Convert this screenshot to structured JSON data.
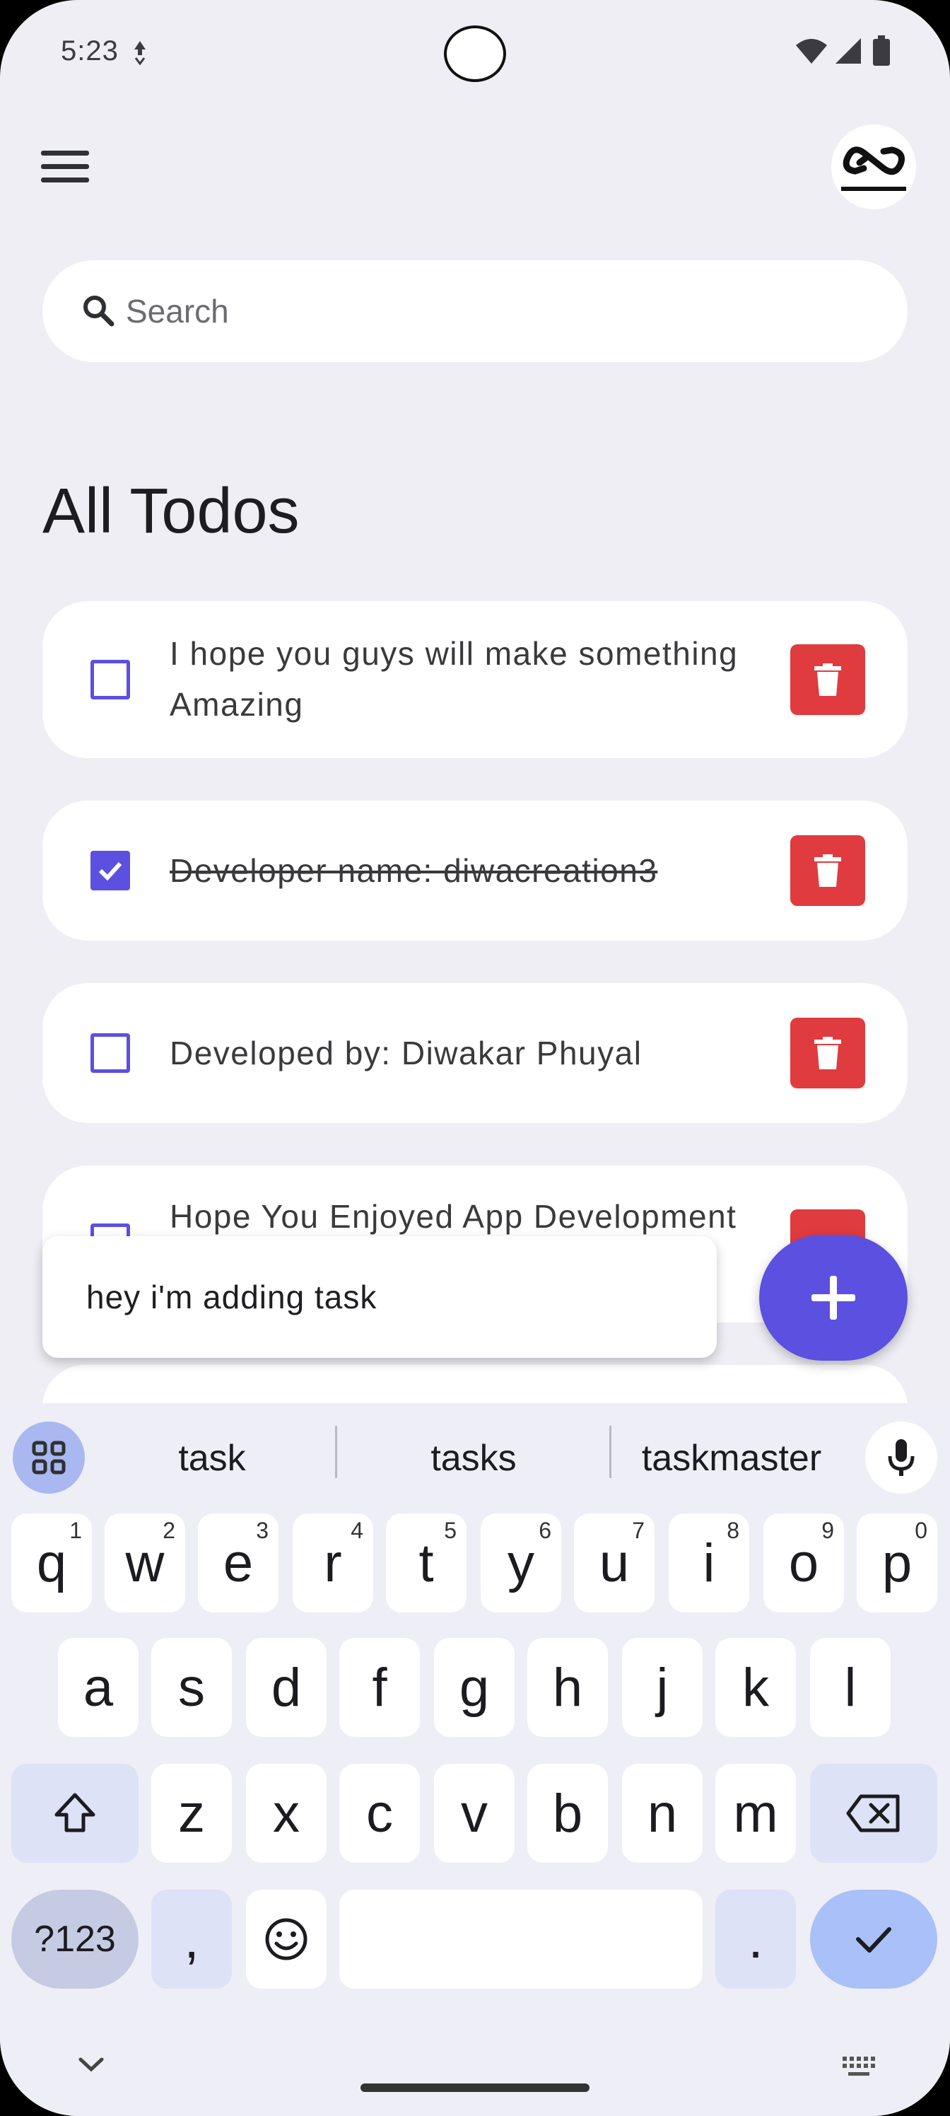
{
  "status_bar": {
    "time": "5:23"
  },
  "search": {
    "placeholder": "Search"
  },
  "page_title": "All Todos",
  "todos": [
    {
      "text": "I hope you guys will make something Amazing",
      "done": false
    },
    {
      "text": "Developer name: diwacreation3",
      "done": true
    },
    {
      "text": "Developed by: Diwakar Phuyal",
      "done": false
    },
    {
      "text": "Hope You Enjoyed App Development",
      "done": false
    }
  ],
  "new_todo_input": {
    "value": "hey i'm adding task"
  },
  "keyboard": {
    "suggestions": [
      "task",
      "tasks",
      "taskmaster"
    ],
    "row1": [
      {
        "key": "q",
        "hint": "1"
      },
      {
        "key": "w",
        "hint": "2"
      },
      {
        "key": "e",
        "hint": "3"
      },
      {
        "key": "r",
        "hint": "4"
      },
      {
        "key": "t",
        "hint": "5"
      },
      {
        "key": "y",
        "hint": "6"
      },
      {
        "key": "u",
        "hint": "7"
      },
      {
        "key": "i",
        "hint": "8"
      },
      {
        "key": "o",
        "hint": "9"
      },
      {
        "key": "p",
        "hint": "0"
      }
    ],
    "row2": [
      "a",
      "s",
      "d",
      "f",
      "g",
      "h",
      "j",
      "k",
      "l"
    ],
    "row3": [
      "z",
      "x",
      "c",
      "v",
      "b",
      "n",
      "m"
    ],
    "symbols_label": "?123",
    "comma_label": ",",
    "period_label": "."
  },
  "colors": {
    "accent": "#5b50e0",
    "delete": "#e03b3f",
    "background": "#eeeef4"
  },
  "icons": [
    "menu-icon",
    "search-icon",
    "checkbox-icon",
    "trash-icon",
    "plus-icon",
    "mic-icon",
    "shift-icon",
    "backspace-icon",
    "emoji-icon",
    "check-icon"
  ]
}
